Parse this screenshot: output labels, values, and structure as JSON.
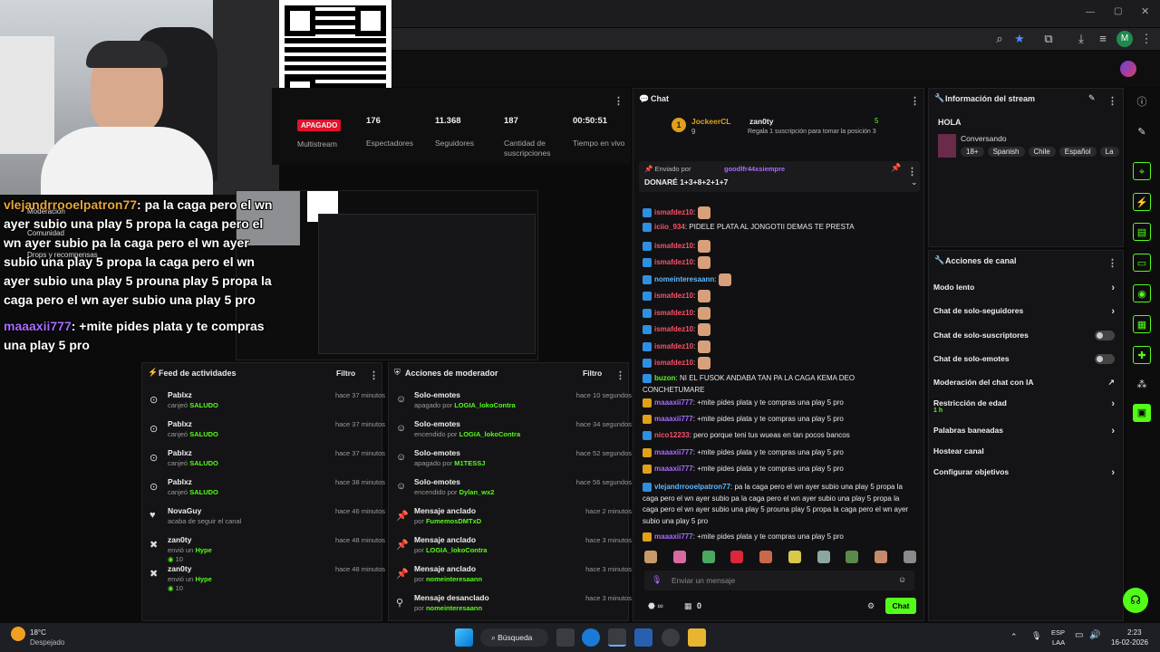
{
  "stream_stats": [
    {
      "value": "APAGADO",
      "label": "Multistream"
    },
    {
      "value": "176",
      "label": "Espectadores"
    },
    {
      "value": "11.368",
      "label": "Seguidores"
    },
    {
      "value": "187",
      "label": "Cantidad de suscripciones"
    },
    {
      "value": "00:50:51",
      "label": "Tiempo en vivo"
    }
  ],
  "overlay": {
    "msg1_user": "vlejandrrooelpatron77",
    "msg1_text": ": pa la caga pero el wn ayer subio una play 5 propa la caga pero el wn ayer subio pa la caga pero el wn ayer subio una play 5 propa la caga pero el wn ayer subio una play 5 prouna play 5 propa la caga pero el wn ayer subio una play 5 pro",
    "msg2_user": "maaaxii777",
    "msg2_text": ": +mite pides plata y te compras una play 5 pro",
    "menu_moderacion": "Moderación",
    "menu_comunidad": "Comunidad",
    "menu_drops": "Drops y recompensas"
  },
  "activity_feed": {
    "title": "Feed de actividades",
    "filter": "Filtro",
    "items": [
      {
        "name": "Pablxz",
        "action": "canjeó",
        "item": "SALUDO",
        "time": "hace 37 minutos",
        "icon": "channel-points-icon"
      },
      {
        "name": "Pablxz",
        "action": "canjeó",
        "item": "SALUDO",
        "time": "hace 37 minutos",
        "icon": "channel-points-icon"
      },
      {
        "name": "Pablxz",
        "action": "canjeó",
        "item": "SALUDO",
        "time": "hace 37 minutos",
        "icon": "channel-points-icon"
      },
      {
        "name": "Pablxz",
        "action": "canjeó",
        "item": "SALUDO",
        "time": "hace 38 minutos",
        "icon": "channel-points-icon"
      },
      {
        "name": "NovaGuy",
        "action": "acaba de seguir el canal",
        "item": "",
        "time": "hace 46 minutos",
        "icon": "heart-icon"
      },
      {
        "name": "zan0ty",
        "action": "envió un",
        "item": "Hype",
        "extra": "10",
        "time": "hace 48 minutos",
        "icon": "kick-icon"
      },
      {
        "name": "zan0ty",
        "action": "envió un",
        "item": "Hype",
        "extra": "10",
        "time": "hace 48 minutos",
        "icon": "kick-icon"
      }
    ]
  },
  "mod_actions": {
    "title": "Acciones de moderador",
    "filter": "Filtro",
    "items": [
      {
        "name": "Solo-emotes",
        "action": "apagado por",
        "user": "LOGIA_lokoContra",
        "time": "hace 10 segundos",
        "icon": "emote-icon"
      },
      {
        "name": "Solo-emotes",
        "action": "encendido por",
        "user": "LOGIA_lokoContra",
        "time": "hace 34 segundos",
        "icon": "emote-icon"
      },
      {
        "name": "Solo-emotes",
        "action": "apagado por",
        "user": "M1TESSJ",
        "time": "hace 52 segundos",
        "icon": "emote-icon"
      },
      {
        "name": "Solo-emotes",
        "action": "encendido por",
        "user": "Dylan_wx2",
        "time": "hace 56 segundos",
        "icon": "emote-icon"
      },
      {
        "name": "Mensaje anclado",
        "action": "por",
        "user": "FumemosDMTxD",
        "time": "hace 2 minutos",
        "icon": "pin-icon"
      },
      {
        "name": "Mensaje anclado",
        "action": "por",
        "user": "LOGIA_lokoContra",
        "time": "hace 3 minutos",
        "icon": "pin-icon"
      },
      {
        "name": "Mensaje anclado",
        "action": "por",
        "user": "nomeinteresaann",
        "time": "hace 3 minutos",
        "icon": "pin-icon"
      },
      {
        "name": "Mensaje desanclado",
        "action": "por",
        "user": "nomeinteresaann",
        "time": "hace 3 minutos",
        "icon": "unpin-icon"
      }
    ]
  },
  "chat": {
    "title": "Chat",
    "gifter_top": "JockeerCL",
    "gifter_top_count": "9",
    "gifter_rank": "1",
    "gifter_next": "zan0ty",
    "gifter_next_count": "5",
    "gift_prompt": "Regala 1 suscripción para tomar la posición 3",
    "pinned_label": "Enviado por",
    "pinned_user": "goodlfr44xsiempre",
    "pinned_text": "DONARÉ 1+3+8+2+1+7",
    "messages": [
      {
        "user": "ismafdez10",
        "text": "",
        "color": "red",
        "emote": true
      },
      {
        "user": "iciio_934",
        "text": "PIDELE PLATA AL JONGOTII DEMAS TE PRESTA",
        "color": "red"
      },
      {
        "user": "ismafdez10",
        "text": "",
        "color": "red",
        "emote": true
      },
      {
        "user": "ismafdez10",
        "text": "",
        "color": "red",
        "emote": true
      },
      {
        "user": "nomeinteresaann",
        "text": "",
        "color": "blue",
        "emote": true
      },
      {
        "user": "ismafdez10",
        "text": "",
        "color": "red",
        "emote": true
      },
      {
        "user": "ismafdez10",
        "text": "",
        "color": "red",
        "emote": true
      },
      {
        "user": "ismafdez10",
        "text": "",
        "color": "red",
        "emote": true
      },
      {
        "user": "ismafdez10",
        "text": "",
        "color": "red",
        "emote": true
      },
      {
        "user": "ismafdez10",
        "text": "",
        "color": "red",
        "emote": true
      },
      {
        "user": "buzon",
        "text": "NI EL FUSOK ANDABA TAN PA LA CAGA KEMA DEO CONCHETUMARE",
        "color": "green"
      },
      {
        "user": "maaaxii777",
        "text": "+mite pides plata y te compras una play 5 pro",
        "color": "purple"
      },
      {
        "user": "maaaxii777",
        "text": "+mite pides plata y te compras una play 5 pro",
        "color": "purple"
      },
      {
        "user": "nico12233",
        "text": "pero porque teni tus wueas en tan pocos bancos",
        "color": "red"
      },
      {
        "user": "maaaxii777",
        "text": "+mite pides plata y te compras una play 5 pro",
        "color": "purple"
      },
      {
        "user": "maaaxii777",
        "text": "+mite pides plata y te compras una play 5 pro",
        "color": "purple"
      },
      {
        "user": "vlejandrrooelpatron77",
        "text": "pa la caga pero el wn ayer subio una play 5 propa la caga pero el wn ayer subio pa la caga pero el wn ayer subio una play 5 propa la caga pero el wn ayer subio una play 5 prouna play 5 propa la caga pero el wn ayer subio una play 5 pro",
        "color": "blue"
      },
      {
        "user": "maaaxii777",
        "text": "+mite pides plata y te compras una play 5 pro",
        "color": "purple"
      }
    ],
    "input_placeholder": "Enviar un mensaje",
    "points": "0",
    "send_label": "Chat",
    "infinity": "∞"
  },
  "stream_info": {
    "title": "Información del stream",
    "stream_title": "HOLA",
    "category": "Conversando",
    "tags": [
      "18+",
      "Spanish",
      "Chile",
      "Español",
      "La"
    ]
  },
  "channel_actions": {
    "title": "Acciones de canal",
    "items": [
      {
        "label": "Modo lento",
        "kind": "chevron"
      },
      {
        "label": "Chat de solo-seguidores",
        "kind": "chevron"
      },
      {
        "label": "Chat de solo-suscriptores",
        "kind": "toggle"
      },
      {
        "label": "Chat de solo-emotes",
        "kind": "toggle"
      },
      {
        "label": "Moderación del chat con IA",
        "kind": "external"
      },
      {
        "label": "Restricción de edad",
        "sub": "1 h",
        "kind": "chevron"
      },
      {
        "label": "Palabras baneadas",
        "kind": "chevron"
      },
      {
        "label": "Hostear canal",
        "kind": "none"
      },
      {
        "label": "Configurar objetivos",
        "kind": "chevron"
      }
    ]
  },
  "taskbar": {
    "weather_temp": "18°C",
    "weather_desc": "Despejado",
    "search": "Búsqueda",
    "lang": "ESP",
    "lang2": "LAA",
    "time": "2:23",
    "date": "16-02-2026"
  },
  "colors": {
    "accent": "#53fc18",
    "bg": "#0b0b0c",
    "panel": "#141416",
    "live_red": "#e1122b"
  }
}
